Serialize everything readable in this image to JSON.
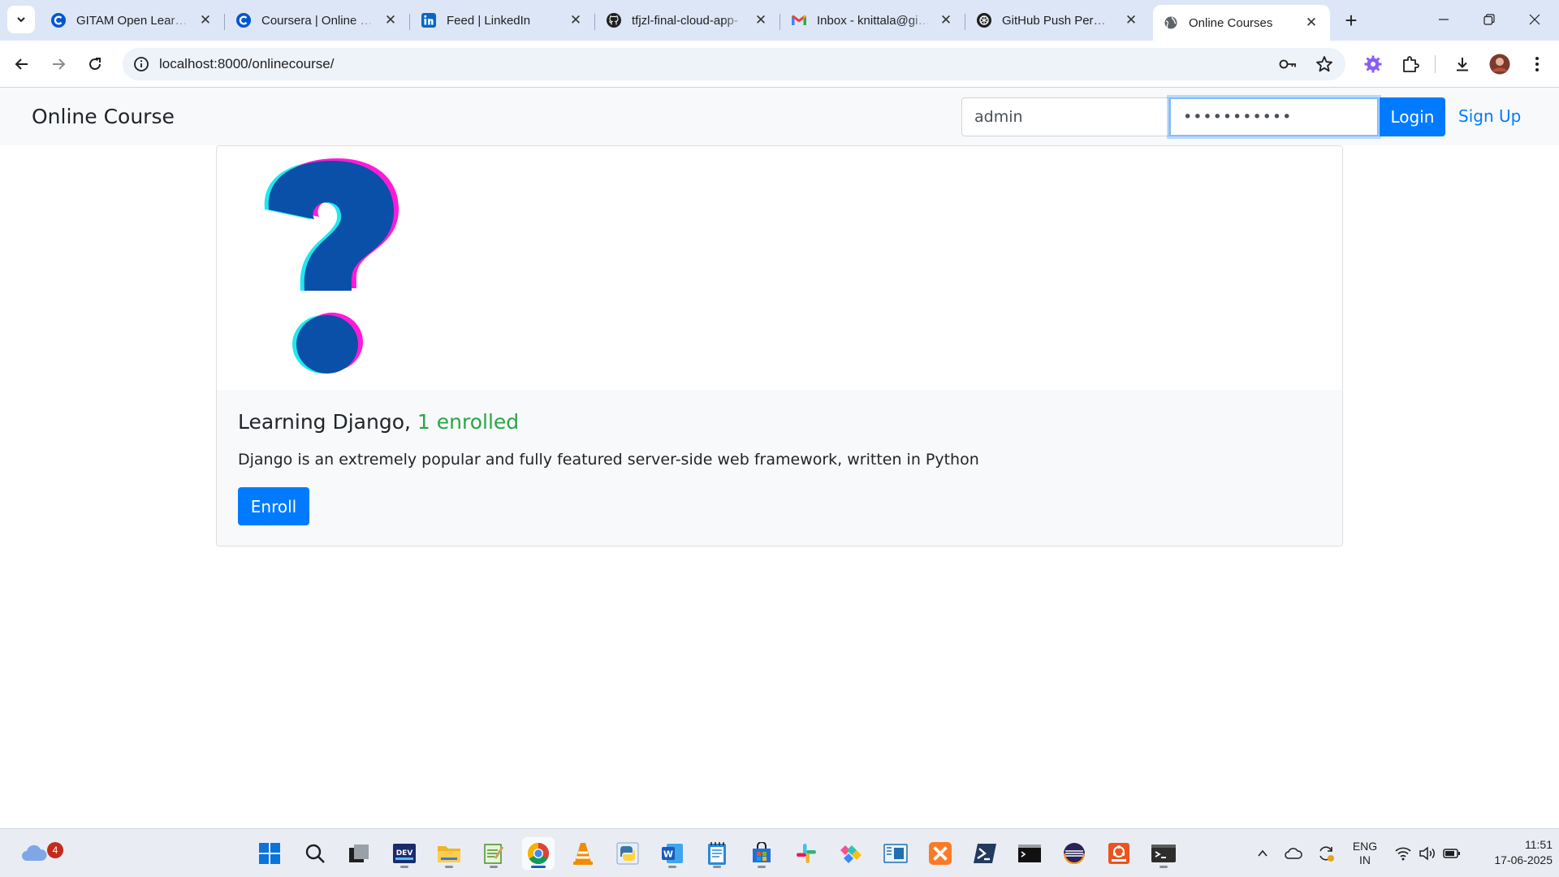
{
  "browser": {
    "tabs": [
      {
        "title": "GITAM Open Learning",
        "icon": "coursera-icon"
      },
      {
        "title": "Coursera | Online Courses",
        "icon": "coursera-icon"
      },
      {
        "title": "Feed | LinkedIn",
        "icon": "linkedin-icon"
      },
      {
        "title": "tfjzl-final-cloud-app-",
        "icon": "github-icon"
      },
      {
        "title": "Inbox - knittala@gitam",
        "icon": "gmail-icon"
      },
      {
        "title": "GitHub Push Permissions",
        "icon": "chatgpt-icon"
      },
      {
        "title": "Online Courses",
        "icon": "globe-icon"
      }
    ],
    "active_tab": 6,
    "url": "localhost:8000/onlinecourse/"
  },
  "page": {
    "brand": "Online Course",
    "login": {
      "username_value": "admin",
      "password_value": "•••••••••••",
      "login_label": "Login",
      "signup_label": "Sign Up"
    },
    "course": {
      "title": "Learning Django,",
      "enrolled_text": "1 enrolled",
      "description": "Django is an extremely popular and fully featured server-side web framework, written in Python",
      "enroll_label": "Enroll",
      "image_icon": "question-mark-icon"
    }
  },
  "taskbar": {
    "weather_badge": "4",
    "lang_line1": "ENG",
    "lang_line2": "IN",
    "time": "11:51",
    "date": "17-06-2025"
  },
  "colors": {
    "primary": "#007bff",
    "success": "#28a745",
    "navbar_bg": "#f8f9fa",
    "tabstrip_bg": "#dce6f7"
  }
}
